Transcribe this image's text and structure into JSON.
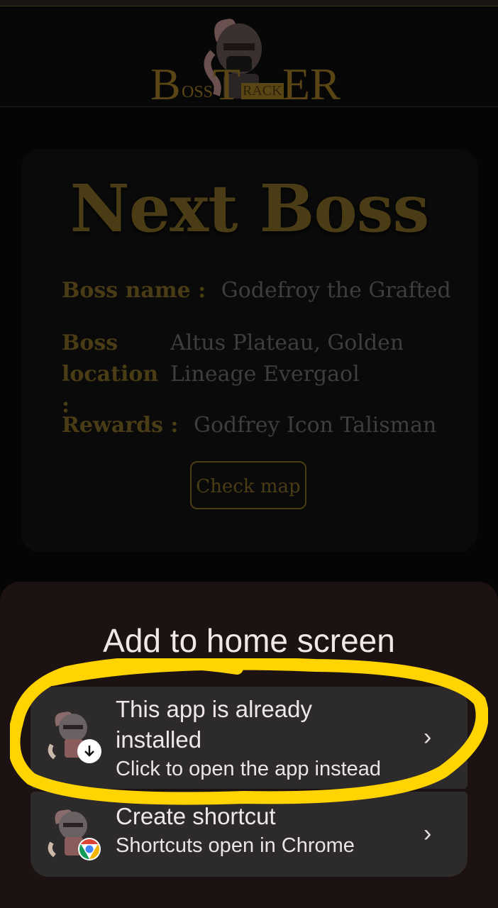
{
  "header": {
    "logo_b": "B",
    "logo_oss": "OSS",
    "logo_t": "T",
    "logo_rack": "RACK",
    "logo_er": "ER"
  },
  "card": {
    "title": "Next Boss",
    "boss_name_label": "Boss name :",
    "boss_name_value": "Godefroy the Grafted",
    "boss_location_label_1": "Boss",
    "boss_location_label_2": "location :",
    "boss_location_value_1": "Altus Plateau, Golden",
    "boss_location_value_2": "Lineage Evergaol",
    "rewards_label": "Rewards :",
    "rewards_value": "Godfrey Icon Talisman",
    "check_map_button": "Check map"
  },
  "sheet": {
    "title": "Add to home screen",
    "option_installed": {
      "title": "This app is already installed",
      "subtitle": "Click to open the app instead",
      "badge_icon": "download-icon"
    },
    "option_shortcut": {
      "title": "Create shortcut",
      "subtitle": "Shortcuts open in Chrome",
      "badge_icon": "chrome-icon"
    }
  },
  "colors": {
    "gold": "#4a3c15",
    "sheet_bg": "#1d1212",
    "option_bg": "#2d2a2c",
    "highlight": "#ffd400"
  }
}
